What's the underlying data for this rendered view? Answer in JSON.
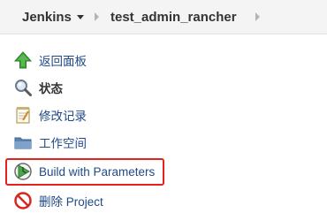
{
  "breadcrumb": {
    "root": "Jenkins",
    "project": "test_admin_rancher"
  },
  "tasks": [
    {
      "label": "返回面板",
      "icon": "green-up-arrow-icon"
    },
    {
      "label": "状态",
      "icon": "magnifier-icon"
    },
    {
      "label": "修改记录",
      "icon": "notepad-icon"
    },
    {
      "label": "工作空间",
      "icon": "folder-icon"
    },
    {
      "label": "Build with Parameters",
      "icon": "build-clock-icon"
    },
    {
      "label": "删除 Project",
      "icon": "no-entry-icon"
    }
  ],
  "colors": {
    "link": "#204a87",
    "highlight_border": "#e3221d",
    "breadcrumb_bg": "#f4f4f4"
  }
}
